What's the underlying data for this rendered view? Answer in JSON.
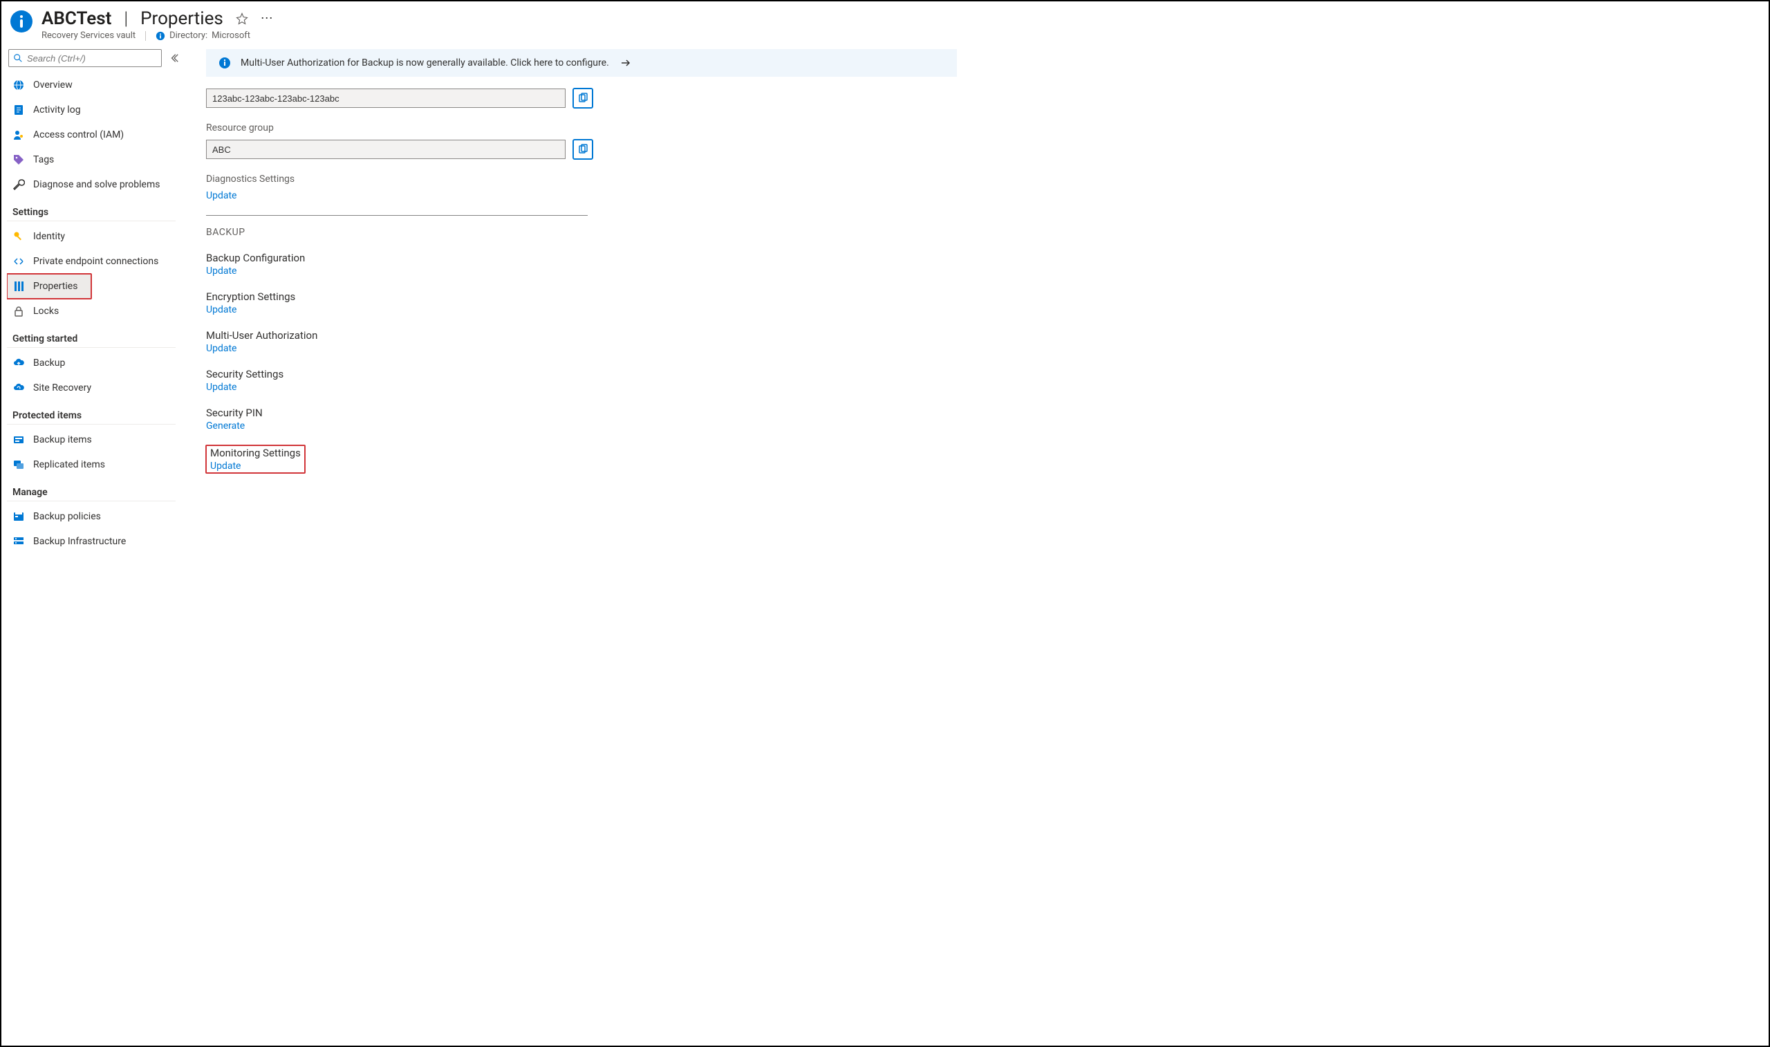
{
  "header": {
    "resource_name": "ABCTest",
    "page_name": "Properties",
    "subtitle": "Recovery Services vault",
    "directory_label": "Directory:",
    "directory_value": "Microsoft"
  },
  "sidebar": {
    "search_placeholder": "Search (Ctrl+/)",
    "items_top": [
      {
        "label": "Overview",
        "icon": "globe"
      },
      {
        "label": "Activity log",
        "icon": "log"
      },
      {
        "label": "Access control (IAM)",
        "icon": "iam"
      },
      {
        "label": "Tags",
        "icon": "tag"
      },
      {
        "label": "Diagnose and solve problems",
        "icon": "wrench"
      }
    ],
    "section_settings": "Settings",
    "items_settings": [
      {
        "label": "Identity",
        "icon": "key"
      },
      {
        "label": "Private endpoint connections",
        "icon": "endpoint"
      },
      {
        "label": "Properties",
        "icon": "properties"
      },
      {
        "label": "Locks",
        "icon": "lock"
      }
    ],
    "section_getting_started": "Getting started",
    "items_getting_started": [
      {
        "label": "Backup",
        "icon": "cloud-up"
      },
      {
        "label": "Site Recovery",
        "icon": "cloud-refresh"
      }
    ],
    "section_protected": "Protected items",
    "items_protected": [
      {
        "label": "Backup items",
        "icon": "backup-items"
      },
      {
        "label": "Replicated items",
        "icon": "replicated"
      }
    ],
    "section_manage": "Manage",
    "items_manage": [
      {
        "label": "Backup policies",
        "icon": "policies"
      },
      {
        "label": "Backup Infrastructure",
        "icon": "infra"
      }
    ]
  },
  "main": {
    "banner_text": "Multi-User Authorization for Backup is now generally available. Click here to configure.",
    "subscription_id_value": "123abc-123abc-123abc-123abc",
    "resource_group_label": "Resource group",
    "resource_group_value": "ABC",
    "diagnostics_label": "Diagnostics Settings",
    "update_label": "Update",
    "generate_label": "Generate",
    "backup_section": "BACKUP",
    "settings": [
      {
        "title": "Backup Configuration",
        "action": "Update"
      },
      {
        "title": "Encryption Settings",
        "action": "Update"
      },
      {
        "title": "Multi-User Authorization",
        "action": "Update"
      },
      {
        "title": "Security Settings",
        "action": "Update"
      },
      {
        "title": "Security PIN",
        "action": "Generate"
      },
      {
        "title": "Monitoring Settings",
        "action": "Update"
      }
    ]
  }
}
